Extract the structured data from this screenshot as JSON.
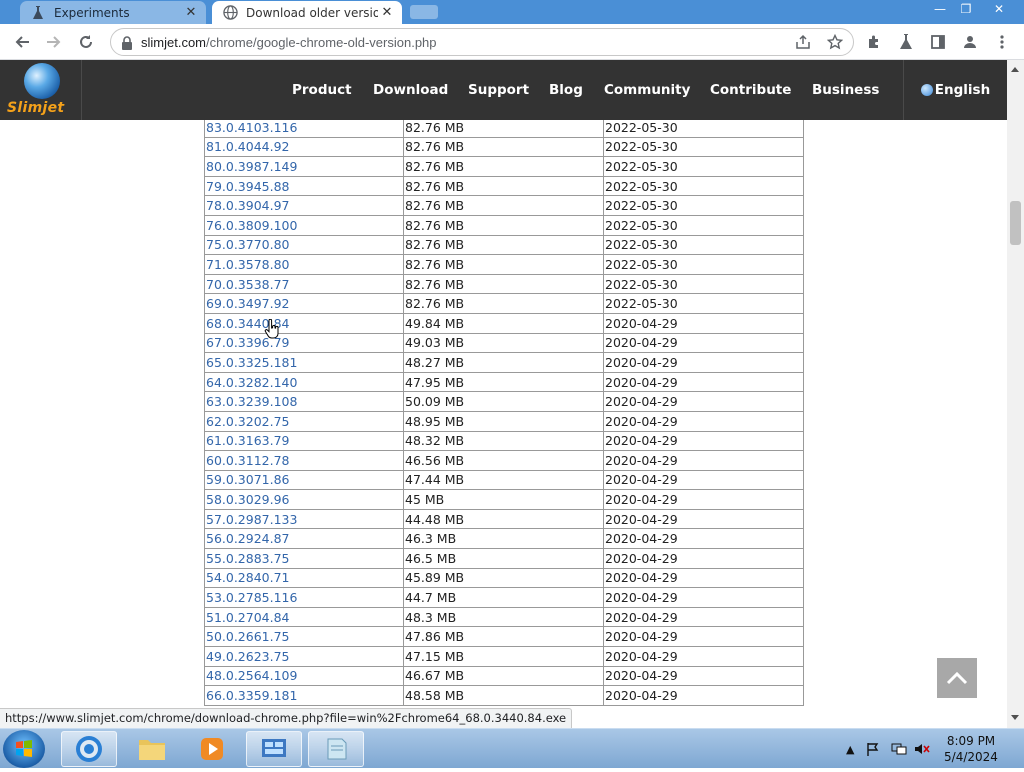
{
  "browser": {
    "tabs": [
      {
        "label": "Experiments",
        "icon": "flask-icon",
        "active": false
      },
      {
        "label": "Download older versio",
        "icon": "globe-icon",
        "active": true
      }
    ],
    "url_host": "slimjet.com",
    "url_path": "/chrome/google-chrome-old-version.php"
  },
  "site": {
    "logo_text": "Slimjet",
    "nav": [
      "Product",
      "Download",
      "Support",
      "Blog",
      "Community",
      "Contribute",
      "Business"
    ],
    "language": "English"
  },
  "versions": {
    "rows": [
      [
        "83.0.4103.116",
        "82.76 MB",
        "2022-05-30"
      ],
      [
        "81.0.4044.92",
        "82.76 MB",
        "2022-05-30"
      ],
      [
        "80.0.3987.149",
        "82.76 MB",
        "2022-05-30"
      ],
      [
        "79.0.3945.88",
        "82.76 MB",
        "2022-05-30"
      ],
      [
        "78.0.3904.97",
        "82.76 MB",
        "2022-05-30"
      ],
      [
        "76.0.3809.100",
        "82.76 MB",
        "2022-05-30"
      ],
      [
        "75.0.3770.80",
        "82.76 MB",
        "2022-05-30"
      ],
      [
        "71.0.3578.80",
        "82.76 MB",
        "2022-05-30"
      ],
      [
        "70.0.3538.77",
        "82.76 MB",
        "2022-05-30"
      ],
      [
        "69.0.3497.92",
        "82.76 MB",
        "2022-05-30"
      ],
      [
        "68.0.3440.84",
        "49.84 MB",
        "2020-04-29"
      ],
      [
        "67.0.3396.79",
        "49.03 MB",
        "2020-04-29"
      ],
      [
        "65.0.3325.181",
        "48.27 MB",
        "2020-04-29"
      ],
      [
        "64.0.3282.140",
        "47.95 MB",
        "2020-04-29"
      ],
      [
        "63.0.3239.108",
        "50.09 MB",
        "2020-04-29"
      ],
      [
        "62.0.3202.75",
        "48.95 MB",
        "2020-04-29"
      ],
      [
        "61.0.3163.79",
        "48.32 MB",
        "2020-04-29"
      ],
      [
        "60.0.3112.78",
        "46.56 MB",
        "2020-04-29"
      ],
      [
        "59.0.3071.86",
        "47.44 MB",
        "2020-04-29"
      ],
      [
        "58.0.3029.96",
        "45 MB",
        "2020-04-29"
      ],
      [
        "57.0.2987.133",
        "44.48 MB",
        "2020-04-29"
      ],
      [
        "56.0.2924.87",
        "46.3 MB",
        "2020-04-29"
      ],
      [
        "55.0.2883.75",
        "46.5 MB",
        "2020-04-29"
      ],
      [
        "54.0.2840.71",
        "45.89 MB",
        "2020-04-29"
      ],
      [
        "53.0.2785.116",
        "44.7 MB",
        "2020-04-29"
      ],
      [
        "51.0.2704.84",
        "48.3 MB",
        "2020-04-29"
      ],
      [
        "50.0.2661.75",
        "47.86 MB",
        "2020-04-29"
      ],
      [
        "49.0.2623.75",
        "47.15 MB",
        "2020-04-29"
      ],
      [
        "48.0.2564.109",
        "46.67 MB",
        "2020-04-29"
      ],
      [
        "66.0.3359.181",
        "48.58 MB",
        "2020-04-29"
      ]
    ]
  },
  "status_url": "https://www.slimjet.com/chrome/download-chrome.php?file=win%2Fchrome64_68.0.3440.84.exe",
  "taskbar": {
    "clock_time": "8:09 PM",
    "clock_date": "5/4/2024",
    "apps": [
      "chrome-icon",
      "folder-icon",
      "media-player-icon",
      "network-app-icon",
      "notepad-icon"
    ]
  },
  "colors": {
    "link": "#3366aa",
    "header_bg": "#333333",
    "logo_text": "#f4a11a"
  }
}
